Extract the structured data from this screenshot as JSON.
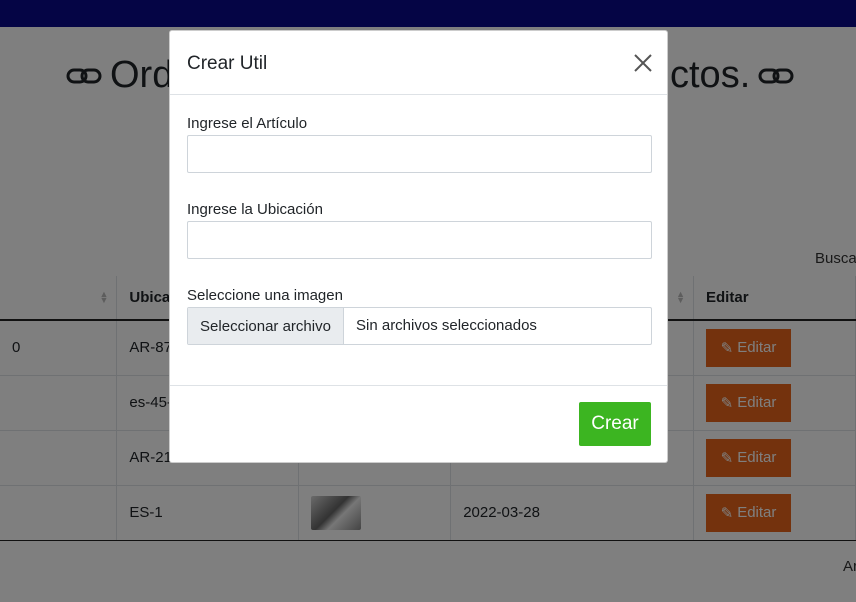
{
  "page": {
    "title_left": "Ord",
    "title_right": "ctos.",
    "search_label": "Busca",
    "footer_text": "Ar"
  },
  "table": {
    "headers": [
      "",
      "Ubica",
      "",
      "",
      "Editar"
    ],
    "rows": [
      {
        "c0": "0",
        "ubic": "AR-87",
        "fecha": "",
        "edit": "Editar"
      },
      {
        "c0": "",
        "ubic": "es-45-",
        "fecha": "",
        "edit": "Editar"
      },
      {
        "c0": "",
        "ubic": "AR-21",
        "fecha": "",
        "edit": "Editar"
      },
      {
        "c0": "",
        "ubic": "ES-1",
        "fecha": "2022-03-28",
        "edit": "Editar"
      }
    ]
  },
  "modal": {
    "title": "Crear Util",
    "field_articulo_label": "Ingrese el Artículo",
    "field_articulo_value": "",
    "field_ubicacion_label": "Ingrese la Ubicación",
    "field_ubicacion_value": "",
    "field_imagen_label": "Seleccione una imagen",
    "file_button_label": "Seleccionar archivo",
    "file_status": "Sin archivos seleccionados",
    "submit_label": "Crear"
  },
  "colors": {
    "topbar": "#0a0a8a",
    "edit_button": "#e8651a",
    "create_button": "#3cb521"
  },
  "icons": [
    "link-icon",
    "sort-icon",
    "edit-icon",
    "close-icon"
  ]
}
